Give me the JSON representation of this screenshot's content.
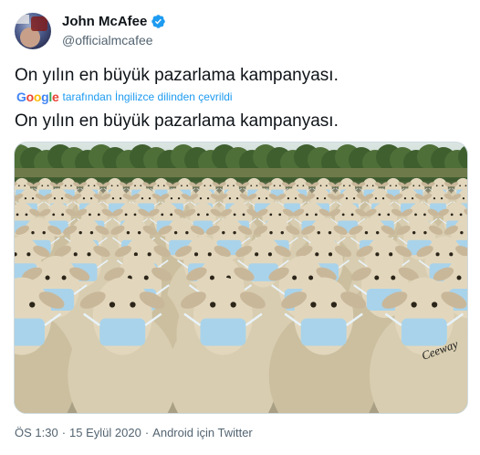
{
  "author": {
    "display_name": "John McAfee",
    "handle": "@officialmcafee",
    "verified": true
  },
  "tweet": {
    "text": "On yılın en büyük pazarlama kampanyası.",
    "translation_note": "tarafından İngilizce dilinden çevrildi",
    "translated_text": "On yılın en büyük pazarlama kampanyası.",
    "translator_brand": "Google"
  },
  "meta": {
    "time": "ÖS 1:30",
    "separator": "·",
    "date": "15 Eylül 2020",
    "source": "Android için Twitter"
  },
  "media": {
    "image_signature": "Ceeway"
  },
  "colors": {
    "text_primary": "#0f1419",
    "text_secondary": "#536471",
    "verified_blue": "#1d9bf0",
    "link_blue": "#1d9bf0"
  }
}
